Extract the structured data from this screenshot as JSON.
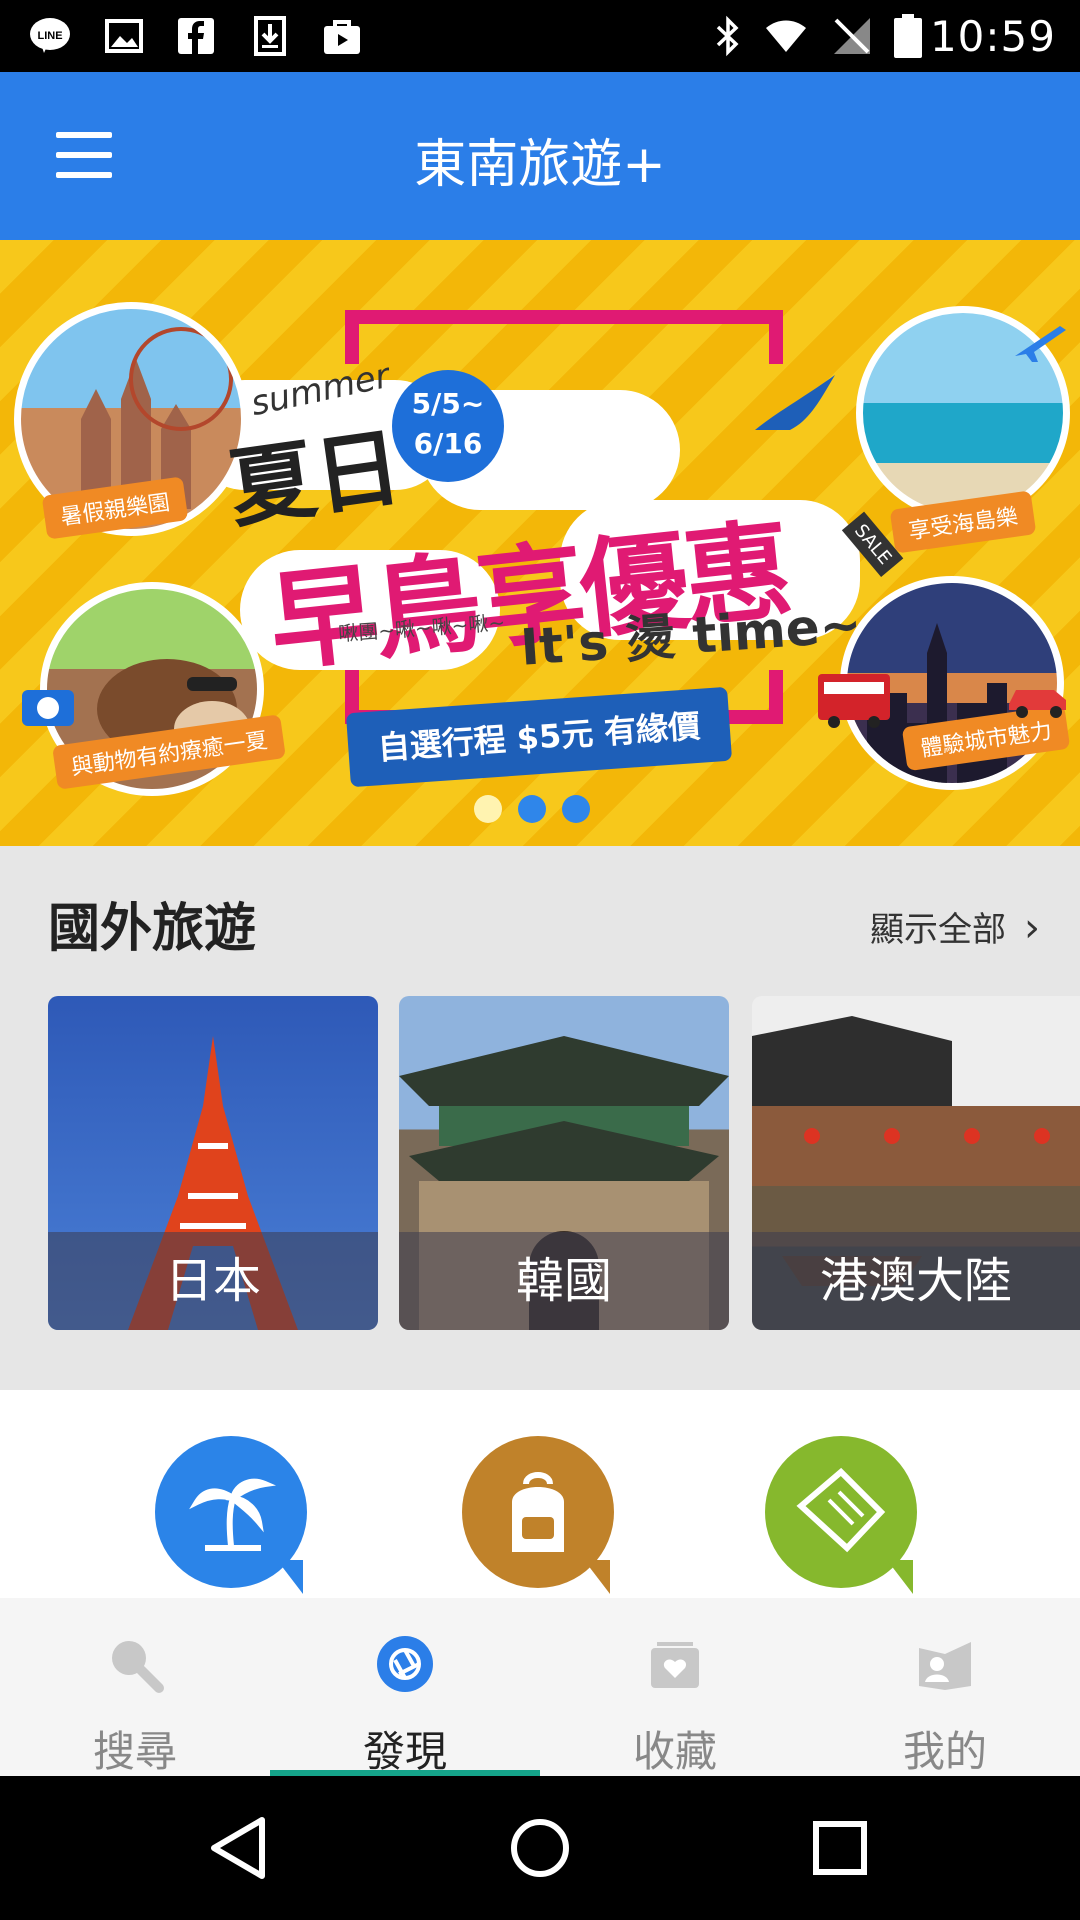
{
  "status_bar": {
    "time": "10:59",
    "left_icons": [
      "line-app-icon",
      "gallery-icon",
      "facebook-icon",
      "download-icon",
      "shopping-bag-icon"
    ],
    "right_icons": [
      "bluetooth-icon",
      "wifi-icon",
      "no-signal-icon",
      "battery-icon"
    ]
  },
  "app_bar": {
    "title": "東南旅遊+",
    "menu_icon": "hamburger-menu-icon",
    "color": "#2b7ee8"
  },
  "banner": {
    "summer": "summer",
    "headline_small": "夏日",
    "date": [
      "5/5~",
      "6/16"
    ],
    "headline_main": "早鳥享優惠",
    "sale_badge": "SALE",
    "sub_text": "啾團~啾~啾~啾~",
    "slogan": "It's 燙 time~",
    "pill": "自選行程 $5元 有緣價",
    "tags": [
      "暑假親樂園",
      "享受海島樂",
      "與動物有約療癒一夏",
      "體驗城市魅力"
    ],
    "pager": {
      "count": 3,
      "active_index": 0
    }
  },
  "section_overseas": {
    "title": "國外旅遊",
    "show_all_label": "顯示全部",
    "cards": [
      {
        "label": "日本"
      },
      {
        "label": "韓國"
      },
      {
        "label": "港澳大陸"
      }
    ]
  },
  "categories": [
    {
      "icon": "palm-tree-icon",
      "color": "#2b84e8"
    },
    {
      "icon": "backpack-icon",
      "color": "#c0822a"
    },
    {
      "icon": "ticket-icon",
      "color": "#86b82d"
    }
  ],
  "tab_bar": {
    "tabs": [
      {
        "label": "搜尋",
        "icon": "search-icon"
      },
      {
        "label": "發現",
        "icon": "discover-icon"
      },
      {
        "label": "收藏",
        "icon": "favorites-icon"
      },
      {
        "label": "我的",
        "icon": "profile-icon"
      }
    ],
    "active_index": 1,
    "active_color": "#15a48a"
  },
  "nav_bar": {
    "buttons": [
      "back-icon",
      "home-icon",
      "recents-icon"
    ]
  }
}
